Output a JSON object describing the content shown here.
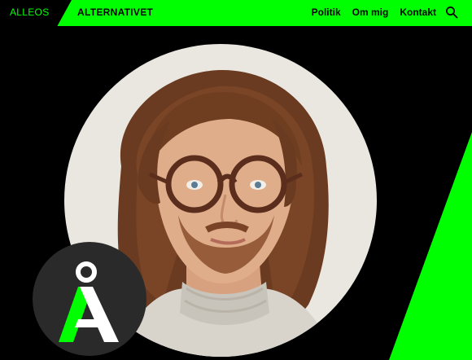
{
  "header": {
    "brand_left": "ALLEOS",
    "brand_right": "ALTERNATIVET",
    "nav": [
      {
        "label": "Politik"
      },
      {
        "label": "Om mig"
      },
      {
        "label": "Kontakt"
      }
    ],
    "search_icon": "search-icon"
  },
  "hero": {
    "portrait": "portrait-photo",
    "logo": "alternativet-logo"
  },
  "colors": {
    "accent": "#00ff00",
    "background": "#000000",
    "portrait_bg": "#eae7e1",
    "badge_bg": "#2a2a2a"
  }
}
